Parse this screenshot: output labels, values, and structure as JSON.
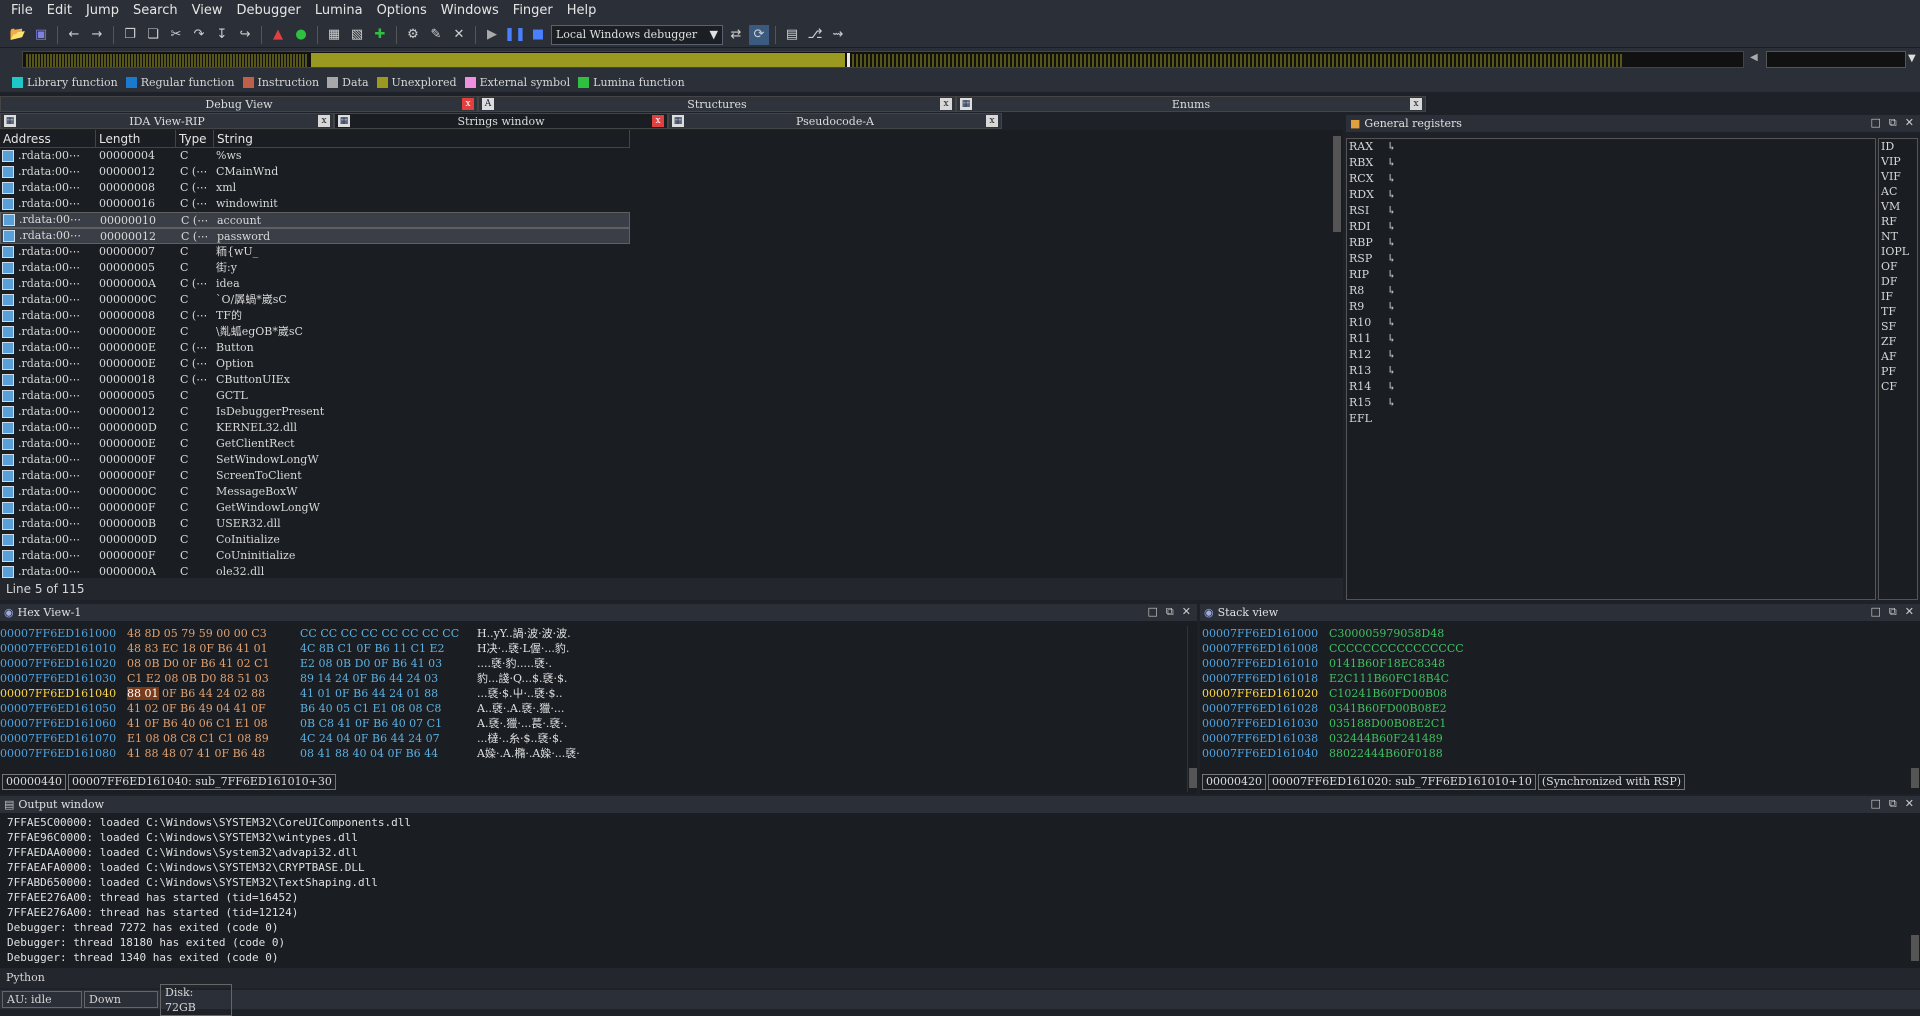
{
  "menu": [
    "File",
    "Edit",
    "Jump",
    "Search",
    "View",
    "Debugger",
    "Lumina",
    "Options",
    "Windows",
    "Finger",
    "Help"
  ],
  "toolbar": {
    "debugger_select": "Local Windows debugger",
    "icons": [
      "open-icon",
      "save-icon",
      "back-icon",
      "forward-icon",
      "copy-icon",
      "paste-icon",
      "cut-icon",
      "step-into-icon",
      "step-over-icon",
      "run-to-cursor-icon",
      "stop-icon",
      "start-icon",
      "breakpoint-icon",
      "trace-icon",
      "add-icon",
      "remove-icon",
      "play-icon",
      "pause-icon",
      "stop-debug-icon"
    ]
  },
  "legend": [
    {
      "label": "Library function",
      "color": "#1ec8c8"
    },
    {
      "label": "Regular function",
      "color": "#1a7ad0"
    },
    {
      "label": "Instruction",
      "color": "#c0604a"
    },
    {
      "label": "Data",
      "color": "#a8a8a8"
    },
    {
      "label": "Unexplored",
      "color": "#9a9a20"
    },
    {
      "label": "External symbol",
      "color": "#f090e0"
    },
    {
      "label": "Lumina function",
      "color": "#30c040"
    }
  ],
  "tabs_top": [
    {
      "label": "Debug View",
      "close": "x"
    },
    {
      "label": "Structures",
      "close": "x"
    },
    {
      "label": "Enums",
      "close": "x"
    }
  ],
  "tabs_second": [
    {
      "label": "IDA View-RIP",
      "close": "x"
    },
    {
      "label": "Strings window",
      "close": "x"
    },
    {
      "label": "Pseudocode-A",
      "close": "x"
    }
  ],
  "strings": {
    "columns": [
      "Address",
      "Length",
      "Type",
      "String"
    ],
    "rows": [
      {
        "addr": ".rdata:00⋯",
        "len": "00000004",
        "type": "C",
        "flag": "",
        "str": "%ws"
      },
      {
        "addr": ".rdata:00⋯",
        "len": "00000012",
        "type": "C",
        "flag": "(⋯",
        "str": "CMainWnd"
      },
      {
        "addr": ".rdata:00⋯",
        "len": "00000008",
        "type": "C",
        "flag": "(⋯",
        "str": "xml"
      },
      {
        "addr": ".rdata:00⋯",
        "len": "00000016",
        "type": "C",
        "flag": "(⋯",
        "str": "windowinit"
      },
      {
        "addr": ".rdata:00⋯",
        "len": "00000010",
        "type": "C",
        "flag": "(⋯",
        "str": "account"
      },
      {
        "addr": ".rdata:00⋯",
        "len": "00000012",
        "type": "C",
        "flag": "(⋯",
        "str": "password"
      },
      {
        "addr": ".rdata:00⋯",
        "len": "00000007",
        "type": "C",
        "flag": "",
        "str": "粫{wU_"
      },
      {
        "addr": ".rdata:00⋯",
        "len": "00000005",
        "type": "C",
        "flag": "",
        "str": "街:y"
      },
      {
        "addr": ".rdata:00⋯",
        "len": "0000000A",
        "type": "C",
        "flag": "(⋯",
        "str": "idea"
      },
      {
        "addr": ".rdata:00⋯",
        "len": "0000000C",
        "type": "C",
        "flag": "",
        "str": "`O/羼蝸*崴sC"
      },
      {
        "addr": ".rdata:00⋯",
        "len": "00000008",
        "type": "C",
        "flag": "(⋯",
        "str": "TF的"
      },
      {
        "addr": ".rdata:00⋯",
        "len": "0000000E",
        "type": "C",
        "flag": "",
        "str": "\\亃蛌egOB*崴sC"
      },
      {
        "addr": ".rdata:00⋯",
        "len": "0000000E",
        "type": "C",
        "flag": "(⋯",
        "str": "Button"
      },
      {
        "addr": ".rdata:00⋯",
        "len": "0000000E",
        "type": "C",
        "flag": "(⋯",
        "str": "Option"
      },
      {
        "addr": ".rdata:00⋯",
        "len": "00000018",
        "type": "C",
        "flag": "(⋯",
        "str": "CButtonUIEx"
      },
      {
        "addr": ".rdata:00⋯",
        "len": "00000005",
        "type": "C",
        "flag": "",
        "str": "GCTL"
      },
      {
        "addr": ".rdata:00⋯",
        "len": "00000012",
        "type": "C",
        "flag": "",
        "str": "IsDebuggerPresent"
      },
      {
        "addr": ".rdata:00⋯",
        "len": "0000000D",
        "type": "C",
        "flag": "",
        "str": "KERNEL32.dll"
      },
      {
        "addr": ".rdata:00⋯",
        "len": "0000000E",
        "type": "C",
        "flag": "",
        "str": "GetClientRect"
      },
      {
        "addr": ".rdata:00⋯",
        "len": "0000000F",
        "type": "C",
        "flag": "",
        "str": "SetWindowLongW"
      },
      {
        "addr": ".rdata:00⋯",
        "len": "0000000F",
        "type": "C",
        "flag": "",
        "str": "ScreenToClient"
      },
      {
        "addr": ".rdata:00⋯",
        "len": "0000000C",
        "type": "C",
        "flag": "",
        "str": "MessageBoxW"
      },
      {
        "addr": ".rdata:00⋯",
        "len": "0000000F",
        "type": "C",
        "flag": "",
        "str": "GetWindowLongW"
      },
      {
        "addr": ".rdata:00⋯",
        "len": "0000000B",
        "type": "C",
        "flag": "",
        "str": "USER32.dll"
      },
      {
        "addr": ".rdata:00⋯",
        "len": "0000000D",
        "type": "C",
        "flag": "",
        "str": "CoInitialize"
      },
      {
        "addr": ".rdata:00⋯",
        "len": "0000000F",
        "type": "C",
        "flag": "",
        "str": "CoUninitialize"
      },
      {
        "addr": ".rdata:00⋯",
        "len": "0000000A",
        "type": "C",
        "flag": "",
        "str": "ole32.dll"
      }
    ],
    "status": "Line 5 of 115"
  },
  "general_registers": {
    "title": "General registers",
    "registers": [
      "RAX",
      "RBX",
      "RCX",
      "RDX",
      "RSI",
      "RDI",
      "RBP",
      "RSP",
      "RIP",
      "R8",
      "R9",
      "R10",
      "R11",
      "R12",
      "R13",
      "R14",
      "R15",
      "EFL"
    ],
    "arrow": "↳",
    "flags": [
      "ID",
      "VIP",
      "VIF",
      "AC",
      "VM",
      "RF",
      "NT",
      "IOPL",
      "OF",
      "DF",
      "IF",
      "TF",
      "SF",
      "ZF",
      "AF",
      "PF",
      "CF"
    ]
  },
  "hex": {
    "title": "Hex View-1",
    "rows": [
      {
        "addr": "00007FF6ED161000",
        "b1": "48 8D 05 79 59 00 00 C3",
        "b2": "CC CC CC CC CC CC CC CC",
        "ascii": "H..yY..諣·波·波·波."
      },
      {
        "addr": "00007FF6ED161010",
        "b1": "48 83 EC 18 0F B6 41 01",
        "b2": "4C 8B C1 0F B6 11 C1 E2",
        "ascii": "H决·..褎·L偓·...豹."
      },
      {
        "addr": "00007FF6ED161020",
        "b1": "08 0B D0 0F B6 41 02 C1",
        "b2": "E2 08 0B D0 0F B6 41 03",
        "ascii": "....褎·豹.....褎·."
      },
      {
        "addr": "00007FF6ED161030",
        "b1": "C1 E2 08 0B D0 88 51 03",
        "b2": "89 14 24 0F B6 44 24 03",
        "ascii": "豹...諓·Q...$.褎·$."
      },
      {
        "addr": "00007FF6ED161040",
        "b1": "88 01 0F B6 44 24 02 88",
        "b2": "41 01 0F B6 44 24 01 88",
        "ascii": "...褎·$.屮·..褎·$.."
      },
      {
        "addr": "00007FF6ED161050",
        "b1": "41 02 0F B6 49 04 41 0F",
        "b2": "B6 40 05 C1 E1 08 08 C8",
        "ascii": "A..褎·.A.褎·.獵·..."
      },
      {
        "addr": "00007FF6ED161060",
        "b1": "41 0F B6 40 06 C1 E1 08",
        "b2": "0B C8 41 0F B6 40 07 C1",
        "ascii": "A.褎·.獵·...萇·.褎·."
      },
      {
        "addr": "00007FF6ED161070",
        "b1": "E1 08 08 C8 C1 C1 08 89",
        "b2": "4C 24 04 0F B6 44 24 07",
        "ascii": "...橽·..糸·$..褎·$."
      },
      {
        "addr": "00007FF6ED161080",
        "b1": "41 88 48 07 41 0F B6 48",
        "b2": "08 41 88 40 04 0F B6 44",
        "ascii": "A媣·.A.橢·.A媣·...褎·"
      }
    ],
    "cur_index": 4,
    "loc_offset": "00000440",
    "loc_text": "00007FF6ED161040: sub_7FF6ED161010+30"
  },
  "stack": {
    "title": "Stack view",
    "rows": [
      {
        "addr": "00007FF6ED161000",
        "val": "C300005979058D48"
      },
      {
        "addr": "00007FF6ED161008",
        "val": "CCCCCCCCCCCCCCCC"
      },
      {
        "addr": "00007FF6ED161010",
        "val": "0141B60F18EC8348"
      },
      {
        "addr": "00007FF6ED161018",
        "val": "E2C111B60FC18B4C"
      },
      {
        "addr": "00007FF6ED161020",
        "val": "C10241B60FD00B08"
      },
      {
        "addr": "00007FF6ED161028",
        "val": "0341B60FD00B08E2"
      },
      {
        "addr": "00007FF6ED161030",
        "val": "035188D00B08E2C1"
      },
      {
        "addr": "00007FF6ED161038",
        "val": "032444B60F241489"
      },
      {
        "addr": "00007FF6ED161040",
        "val": "88022444B60F0188"
      }
    ],
    "cur_index": 4,
    "loc_offset": "00000420",
    "loc_text": "00007FF6ED161020: sub_7FF6ED161010+10",
    "loc_sync": "(Synchronized with RSP)"
  },
  "output": {
    "title": "Output window",
    "lines": [
      "7FFAE5C00000: loaded C:\\Windows\\SYSTEM32\\CoreUIComponents.dll",
      "7FFAE96C0000: loaded C:\\Windows\\SYSTEM32\\wintypes.dll",
      "7FFAEDAA0000: loaded C:\\Windows\\System32\\advapi32.dll",
      "7FFAEAFA0000: loaded C:\\Windows\\SYSTEM32\\CRYPTBASE.DLL",
      "7FFABD650000: loaded C:\\Windows\\SYSTEM32\\TextShaping.dll",
      "7FFAEE276A00: thread has started (tid=16452)",
      "7FFAEE276A00: thread has started (tid=12124)",
      "Debugger: thread 7272 has exited (code 0)",
      "Debugger: thread 18180 has exited (code 0)",
      "Debugger: thread 1340 has exited (code 0)"
    ]
  },
  "python_label": "Python",
  "statusbar": {
    "au": "AU:  idle",
    "dir": "Down",
    "disk": "Disk: 72GB"
  }
}
